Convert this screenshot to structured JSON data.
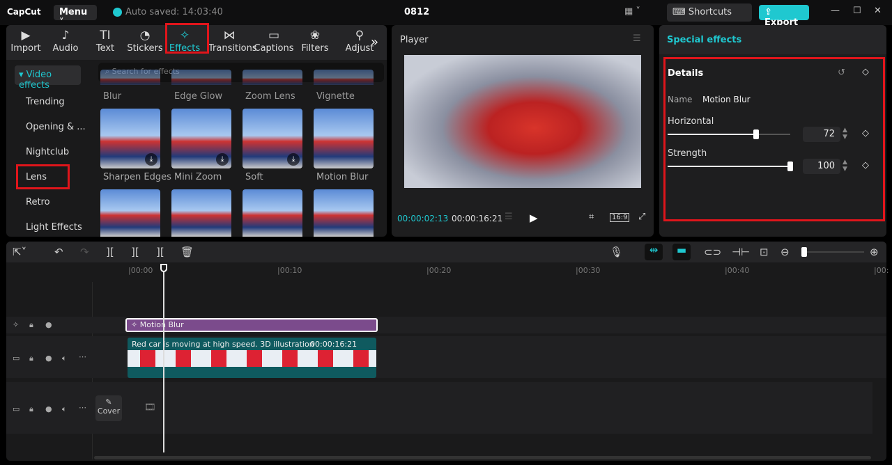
{
  "app": {
    "logo": "CapCut",
    "menu": "Menu",
    "autosave": "Auto saved: 14:03:40",
    "project": "0812",
    "shortcuts": "Shortcuts",
    "export": "Export"
  },
  "tabs": [
    {
      "label": "Import",
      "icon": "▶"
    },
    {
      "label": "Audio",
      "icon": "♪"
    },
    {
      "label": "Text",
      "icon": "TI"
    },
    {
      "label": "Stickers",
      "icon": "◔"
    },
    {
      "label": "Effects",
      "icon": "✧"
    },
    {
      "label": "Transitions",
      "icon": "⋈"
    },
    {
      "label": "Captions",
      "icon": "▭"
    },
    {
      "label": "Filters",
      "icon": "❀"
    },
    {
      "label": "Adjust",
      "icon": "⚲"
    }
  ],
  "categories": {
    "header": "▾ Video effects",
    "items": [
      "Trending",
      "Opening & ...",
      "Nightclub",
      "Lens",
      "Retro",
      "Light Effects"
    ]
  },
  "search": {
    "placeholder": "Search for effects"
  },
  "effects_row1": [
    "Blur",
    "Edge Glow",
    "Zoom Lens",
    "Vignette"
  ],
  "effects_row2": [
    "Sharpen Edges",
    "Mini Zoom",
    "Soft",
    "Motion Blur"
  ],
  "player": {
    "title": "Player",
    "current": "00:00:02:13",
    "total": "00:00:16:21",
    "ratio": "16:9"
  },
  "special": {
    "title": "Special effects",
    "details": "Details",
    "name_label": "Name",
    "name_value": "Motion Blur",
    "horizontal_label": "Horizontal",
    "horizontal_value": "72",
    "horizontal_fraction": 0.72,
    "strength_label": "Strength",
    "strength_value": "100",
    "strength_fraction": 1.0
  },
  "timeline": {
    "ticks": [
      "00:00",
      "00:10",
      "00:20",
      "00:30",
      "00:40",
      "00:"
    ],
    "effect_clip": "Motion Blur",
    "video_clip": "Red car is moving at high speed. 3D illustration",
    "video_duration": "00:00:16:21",
    "cover": "Cover"
  },
  "colors": {
    "accent": "#1fc8d0",
    "highlight": "#e0151b",
    "effect_clip": "#7b4b8c",
    "video_clip": "#0f5a5f"
  }
}
